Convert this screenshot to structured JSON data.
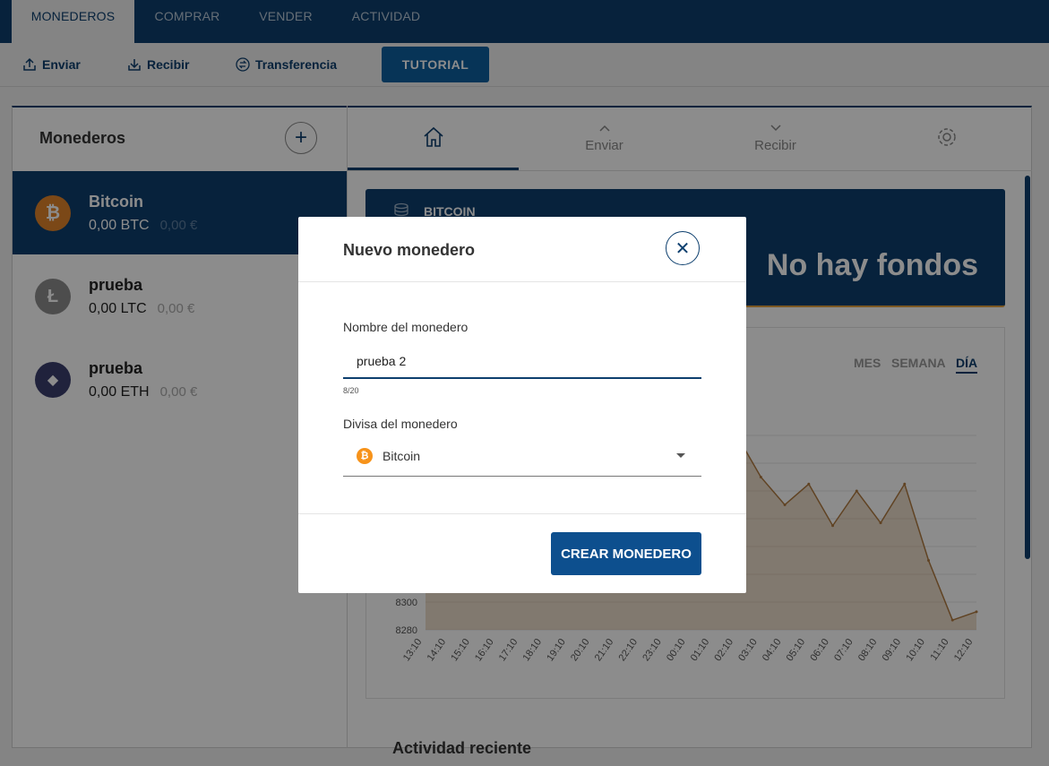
{
  "topnav": {
    "tabs": [
      {
        "label": "MONEDEROS",
        "active": true
      },
      {
        "label": "COMPRAR",
        "active": false
      },
      {
        "label": "VENDER",
        "active": false
      },
      {
        "label": "ACTIVIDAD",
        "active": false
      }
    ]
  },
  "actions": {
    "send": "Enviar",
    "receive": "Recibir",
    "transfer": "Transferencia",
    "tutorial": "TUTORIAL"
  },
  "sidebar": {
    "title": "Monederos",
    "add_icon": "plus-icon",
    "wallets": [
      {
        "name": "Bitcoin",
        "amount": "0,00 BTC",
        "fiat": "0,00 €",
        "color": "#e0832a",
        "symbol": "₿",
        "active": true
      },
      {
        "name": "prueba",
        "amount": "0,00 LTC",
        "fiat": "0,00 €",
        "color": "#8c8c8c",
        "symbol": "Ł",
        "active": false
      },
      {
        "name": "prueba",
        "amount": "0,00 ETH",
        "fiat": "0,00 €",
        "color": "#3b3f6e",
        "symbol": "◆",
        "active": false
      }
    ]
  },
  "detail": {
    "tabs": [
      {
        "label": "",
        "icon": "home-icon"
      },
      {
        "label": "Enviar",
        "icon": "chevron-up-icon"
      },
      {
        "label": "Recibir",
        "icon": "chevron-down-icon"
      },
      {
        "label": "",
        "icon": "gear-icon"
      }
    ],
    "banner_title": "BITCOIN",
    "no_funds": "No hay fondos",
    "periods": [
      "MES",
      "SEMANA",
      "DÍA"
    ],
    "active_period": "DÍA",
    "recent_title": "Actividad reciente"
  },
  "chart_data": {
    "type": "area",
    "x": [
      "13:10",
      "14:10",
      "15:10",
      "16:10",
      "17:10",
      "18:10",
      "19:10",
      "20:10",
      "21:10",
      "22:10",
      "23:10",
      "00:10",
      "01:10",
      "02:10",
      "03:10",
      "04:10",
      "05:10",
      "06:10",
      "07:10",
      "08:10",
      "09:10",
      "10:10",
      "11:10",
      "12:10"
    ],
    "y_ticks": [
      8280,
      8300
    ],
    "values": [
      8330,
      8330,
      8330,
      8330,
      8330,
      8330,
      8330,
      8330,
      8330,
      8330,
      8330,
      8330,
      8330,
      8420,
      8390,
      8370,
      8385,
      8355,
      8380,
      8357,
      8385,
      8330,
      8287,
      8293
    ],
    "color": "#c89a6a"
  },
  "modal": {
    "title": "Nuevo monedero",
    "close_icon": "close-icon",
    "name_label": "Nombre del monedero",
    "name_value": "prueba 2",
    "counter": "8/20",
    "currency_label": "Divisa del monedero",
    "currency_value": "Bitcoin",
    "create": "CREAR MONEDERO"
  }
}
